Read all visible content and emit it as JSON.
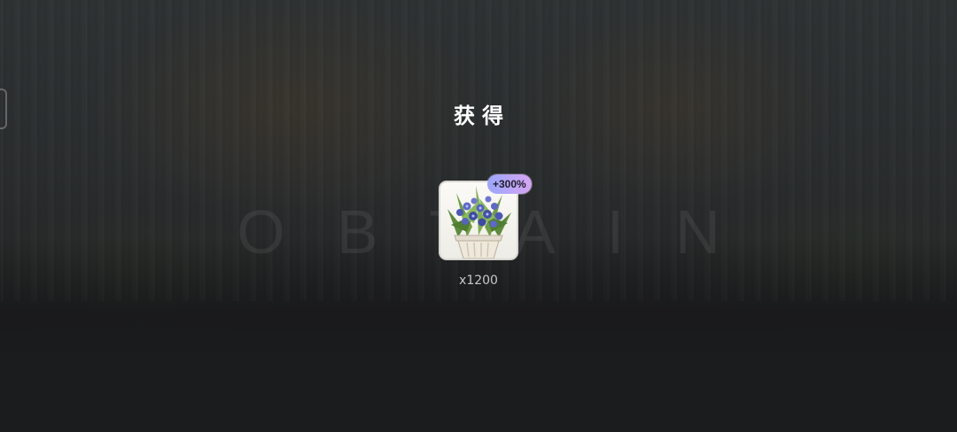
{
  "title": "获得",
  "watermark": "OBTAIN",
  "reward": {
    "icon": "potted-blue-flower-plant-icon",
    "bonus_badge": "+300%",
    "quantity": "x1200"
  },
  "colors": {
    "badge_start": "#9aa6ff",
    "badge_end": "#d7a5f2",
    "title": "#ffffff",
    "quantity": "#c8c8c8"
  }
}
